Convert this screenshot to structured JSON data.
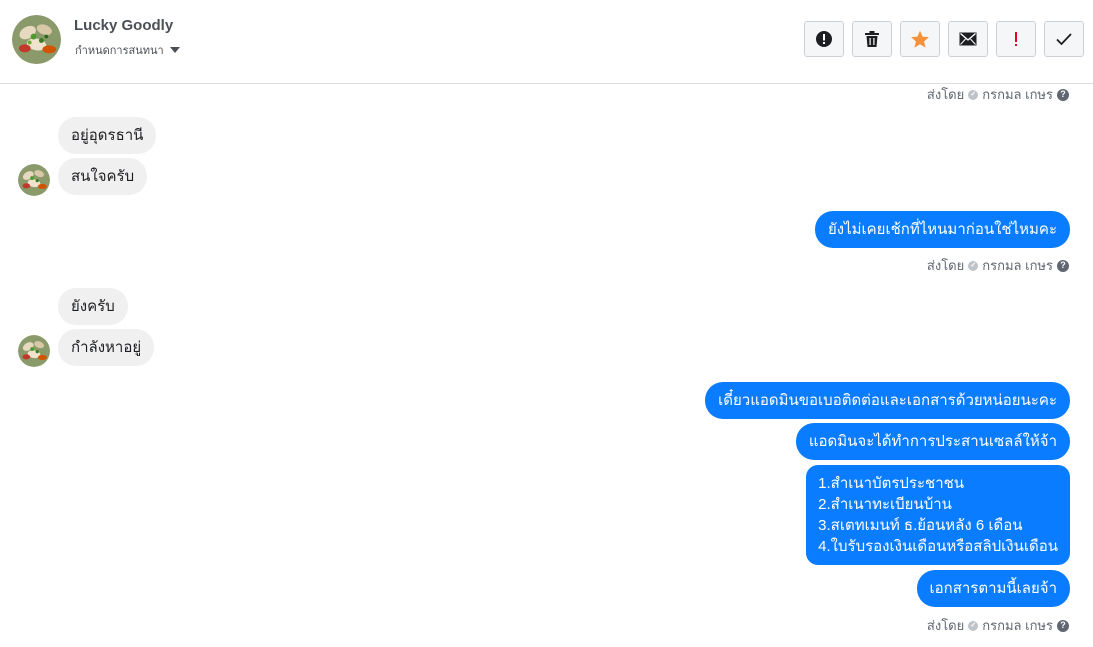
{
  "header": {
    "contact_name": "Lucky Goodly",
    "settings_label": "กำหนดการสนทนา",
    "toolbar": [
      {
        "name": "report-spam-button",
        "icon": "alert-circle-icon"
      },
      {
        "name": "delete-button",
        "icon": "trash-icon"
      },
      {
        "name": "star-button",
        "icon": "star-icon"
      },
      {
        "name": "mark-unread-button",
        "icon": "envelope-icon"
      },
      {
        "name": "important-button",
        "icon": "exclamation-icon"
      },
      {
        "name": "done-button",
        "icon": "checkmark-icon"
      }
    ],
    "colors": {
      "star": "#f7923b",
      "important": "#e4002b"
    }
  },
  "sent_by": {
    "label": "ส่งโดย",
    "name": "กรกมล เกษร",
    "help_icon": "?"
  },
  "messages": {
    "m1": "อยู่อุดรธานี",
    "m2": "สนใจครับ",
    "m3": "ยังไม่เคยเช้กที่ไหนมาก่อนใช่ไหมคะ",
    "m4": "ยังครับ",
    "m5": "กำลังหาอยู่",
    "m6": "เดี๋ยวแอดมินขอเบอติดต่อและเอกสารด้วยหน่อยนะคะ",
    "m7": "แอดมินจะได้ทำการประสานเซลล์ให้จ้า",
    "m8_lines": [
      "1.สำเนาบัตรประชาชน",
      "2.สำเนาทะเบียนบ้าน",
      "3.สเตทเมนท์ ธ.ย้อนหลัง 6 เดือน",
      "4.ใบรับรองเงินเดือนหรือสลิปเงินเดือน"
    ],
    "m9": "เอกสารตามนี้เลยจ้า"
  },
  "colors": {
    "outgoing_bubble": "#0a7cff",
    "incoming_bubble": "#f1f0f0"
  }
}
